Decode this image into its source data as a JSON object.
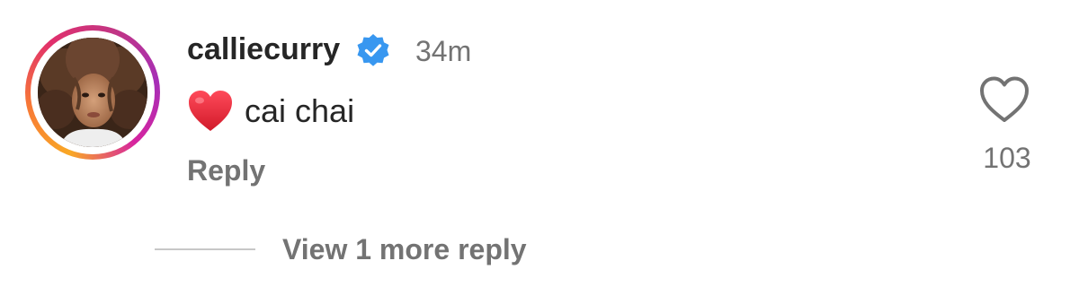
{
  "comment": {
    "username": "calliecurry",
    "verified_icon": "verified-badge-icon",
    "timestamp": "34m",
    "emoji_icon": "red-heart-emoji",
    "text": "cai chai",
    "reply_label": "Reply",
    "like_icon": "heart-outline-icon",
    "like_count": "103",
    "view_more_label": "View 1 more reply",
    "colors": {
      "verified_blue": "#3897f0",
      "heart_red": "#e0245e",
      "primary_text": "#262626",
      "secondary_text": "#737373"
    }
  }
}
